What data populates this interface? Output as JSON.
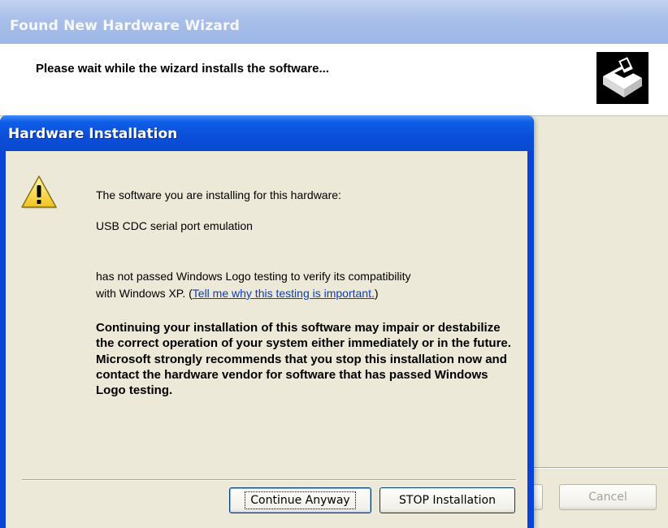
{
  "wizard": {
    "title": "Found New Hardware Wizard",
    "heading": "Please wait while the wizard installs the software...",
    "next_button_label": "",
    "cancel_button_label": "Cancel"
  },
  "dialog": {
    "title": "Hardware Installation",
    "intro": "The software you are installing for this hardware:",
    "device_name": "USB CDC serial port emulation",
    "logo_line1": "has not passed Windows Logo testing to verify its compatibility",
    "logo_line2_prefix": "with Windows XP. (",
    "link_text": "Tell me why this testing is important.",
    "logo_line2_suffix": ")",
    "warning": "Continuing your installation of this software may impair or destabilize the correct operation of your system either immediately or in the future. Microsoft strongly recommends that you stop this installation now and contact the hardware vendor for software that has passed Windows Logo testing.",
    "continue_label": "Continue Anyway",
    "stop_label": "STOP Installation"
  },
  "icons": {
    "wizard_icon": "hardware-install-icon",
    "warning_icon": "warning-triangle-icon"
  },
  "colors": {
    "titlebar_blue": "#0a49d0",
    "dialog_face": "#ece9d8",
    "link_blue": "#0b3dbd",
    "inactive_title": "#a8bfe9"
  }
}
